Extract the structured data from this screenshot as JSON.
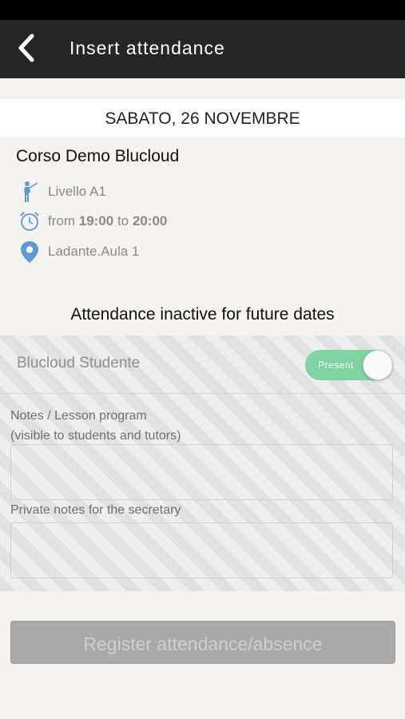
{
  "header": {
    "title": "Insert attendance",
    "back_icon": "chevron-left-icon"
  },
  "date_label": "SABATO, 26 NOVEMBRE",
  "course": {
    "title": "Corso Demo Blucloud",
    "level": "Livello A1",
    "time": {
      "from_word": "from",
      "start": "19:00",
      "to_word": "to",
      "end": "20:00"
    },
    "location": "Ladante.Aula 1",
    "icons": {
      "level": "teacher-icon",
      "time": "alarm-clock-icon",
      "location": "map-pin-icon"
    },
    "icon_color": "#5b9bd5"
  },
  "attendance": {
    "inactive_message": "Attendance inactive for future dates",
    "student_name": "Blucloud Studente",
    "status_label": "Present",
    "status_on": true,
    "status_color": "#7ed3a1"
  },
  "notes": {
    "label_line1": "Notes / Lesson program",
    "label_line2": "(visible to students and tutors)",
    "value": "",
    "private_label": "Private notes for the secretary",
    "private_value": ""
  },
  "footer": {
    "register_label": "Register attendance/absence"
  }
}
